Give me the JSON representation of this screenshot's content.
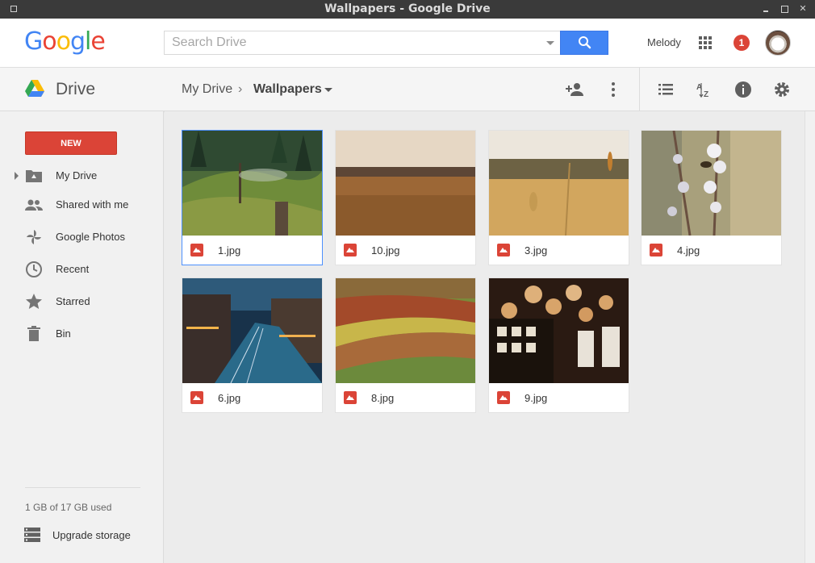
{
  "window": {
    "title": "Wallpapers - Google Drive"
  },
  "header": {
    "logo": "Google",
    "search_placeholder": "Search Drive",
    "user_name": "Melody",
    "notification_count": "1"
  },
  "toolbar": {
    "app_title": "Drive",
    "breadcrumb_root": "My Drive",
    "breadcrumb_separator": "›",
    "breadcrumb_current": "Wallpapers"
  },
  "sidebar": {
    "new_label": "NEW",
    "items": [
      {
        "label": "My Drive",
        "icon": "drive-folder-icon"
      },
      {
        "label": "Shared with me",
        "icon": "people-icon"
      },
      {
        "label": "Google Photos",
        "icon": "photos-pinwheel-icon"
      },
      {
        "label": "Recent",
        "icon": "clock-icon"
      },
      {
        "label": "Starred",
        "icon": "star-icon"
      },
      {
        "label": "Bin",
        "icon": "trash-icon"
      }
    ],
    "storage": "1 GB of 17 GB used",
    "upgrade_label": "Upgrade storage"
  },
  "files": [
    {
      "name": "1.jpg",
      "selected": true
    },
    {
      "name": "10.jpg"
    },
    {
      "name": "3.jpg"
    },
    {
      "name": "4.jpg"
    },
    {
      "name": "6.jpg"
    },
    {
      "name": "8.jpg"
    },
    {
      "name": "9.jpg"
    }
  ],
  "colors": {
    "accent_blue": "#4285f4",
    "new_red": "#db4437",
    "selection_blue": "#4d90fe"
  }
}
